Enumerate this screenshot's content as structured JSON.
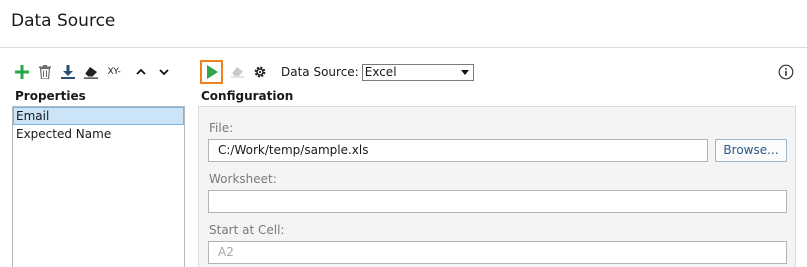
{
  "window": {
    "title": "Data Source"
  },
  "toolbar_left": {
    "buttons": [
      {
        "icon": "plus-icon",
        "color": "#2aa84a"
      },
      {
        "icon": "trash-icon"
      },
      {
        "icon": "download-icon",
        "color": "#2b4f73"
      },
      {
        "icon": "eraser-icon"
      },
      {
        "icon": "xy-icon",
        "text": "XY-"
      },
      {
        "icon": "chevron-up-icon"
      },
      {
        "icon": "chevron-down-icon"
      }
    ]
  },
  "toolbar_right": {
    "run_icon": "play-icon",
    "run_color": "#2aa84a",
    "run_highlight_color": "#f0821e",
    "clear_icon": "eraser-icon",
    "settings_icon": "gear-icon",
    "data_source_label": "Data Source:",
    "data_source_value": "Excel",
    "info_icon": "info-icon"
  },
  "properties": {
    "heading": "Properties",
    "items": [
      {
        "label": "Email",
        "selected": true
      },
      {
        "label": "Expected Name",
        "selected": false
      }
    ]
  },
  "configuration": {
    "heading": "Configuration",
    "file_label": "File:",
    "file_value": "C:/Work/temp/sample.xls",
    "browse_label": "Browse...",
    "worksheet_label": "Worksheet:",
    "worksheet_value": "",
    "start_cell_label": "Start at Cell:",
    "start_cell_value": "A2"
  },
  "colors": {
    "selection_bg": "#cce4f7",
    "accent_green": "#2aa84a",
    "accent_orange": "#f0821e"
  }
}
